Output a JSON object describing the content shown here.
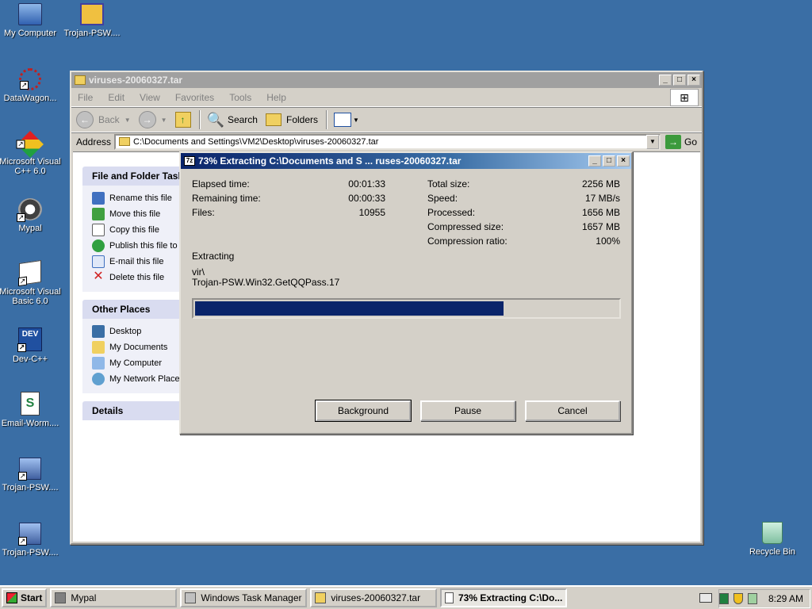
{
  "desktop": {
    "icons": [
      {
        "label": "My Computer"
      },
      {
        "label": "Trojan-PSW...."
      },
      {
        "label": "DataWagon..."
      },
      {
        "label": "Microsoft Visual C++ 6.0"
      },
      {
        "label": "Mypal"
      },
      {
        "label": "Microsoft Visual Basic 6.0"
      },
      {
        "label": "Dev-C++"
      },
      {
        "label": "Email-Worm...."
      },
      {
        "label": "Trojan-PSW...."
      },
      {
        "label": "Trojan-PSW...."
      },
      {
        "label": "Recycle Bin"
      }
    ]
  },
  "explorer": {
    "title": "viruses-20060327.tar",
    "menu": [
      "File",
      "Edit",
      "View",
      "Favorites",
      "Tools",
      "Help"
    ],
    "toolbar": {
      "back": "Back",
      "search": "Search",
      "folders": "Folders"
    },
    "address": {
      "label": "Address",
      "value": "C:\\Documents and Settings\\VM2\\Desktop\\viruses-20060327.tar",
      "go": "Go"
    },
    "tasks": {
      "title": "File and Folder Tasks",
      "items": [
        "Rename this file",
        "Move this file",
        "Copy this file",
        "Publish this file to",
        "E-mail this file",
        "Delete this file"
      ]
    },
    "places": {
      "title": "Other Places",
      "items": [
        "Desktop",
        "My Documents",
        "My Computer",
        "My Network Places"
      ]
    },
    "details": {
      "title": "Details"
    }
  },
  "dialog": {
    "icon_text": "7z",
    "title": "73% Extracting C:\\Documents and S ... ruses-20060327.tar",
    "elapsed_label": "Elapsed time:",
    "elapsed": "00:01:33",
    "remaining_label": "Remaining time:",
    "remaining": "00:00:33",
    "files_label": "Files:",
    "files": "10955",
    "total_label": "Total size:",
    "total": "2256 MB",
    "speed_label": "Speed:",
    "speed": "17 MB/s",
    "processed_label": "Processed:",
    "processed": "1656 MB",
    "compressed_label": "Compressed size:",
    "compressed": "1657 MB",
    "ratio_label": "Compression ratio:",
    "ratio": "100%",
    "status": "Extracting",
    "path_line1": "vir\\",
    "path_line2": "Trojan-PSW.Win32.GetQQPass.17",
    "progress_percent": 73,
    "buttons": {
      "background": "Background",
      "pause": "Pause",
      "cancel": "Cancel"
    }
  },
  "taskbar": {
    "start": "Start",
    "items": [
      "Mypal",
      "Windows Task Manager",
      "viruses-20060327.tar",
      "73% Extracting C:\\Do..."
    ],
    "clock": "8:29 AM"
  },
  "colors": {
    "desktop": "#3a6ea5",
    "title_active": "#0a246a",
    "progress": "#0a246a"
  }
}
